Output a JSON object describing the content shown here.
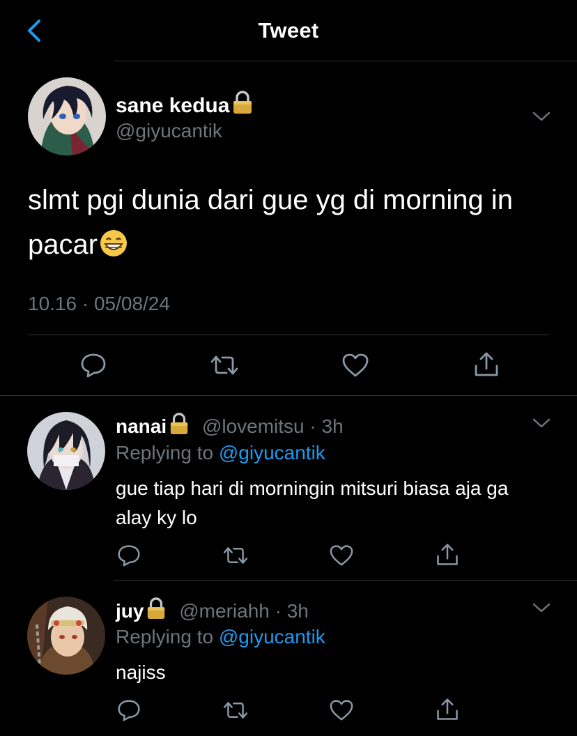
{
  "header": {
    "title": "Tweet"
  },
  "tweet": {
    "display_name": "sane kedua",
    "handle": "@giyucantik",
    "text": "slmt pgi dunia dari gue yg di morning in pacar",
    "timestamp": "10.16 · 05/08/24"
  },
  "replies": [
    {
      "display_name": "nanai",
      "handle": "@lovemitsu",
      "time": "· 3h",
      "replying_label": "Replying to",
      "replying_to": "@giyucantik",
      "text": "gue tiap hari di morningin mitsuri biasa aja ga alay ky lo"
    },
    {
      "display_name": "juy",
      "handle": "@meriahh",
      "time": "· 3h",
      "replying_label": "Replying to",
      "replying_to": "@giyucantik",
      "text": "najiss"
    }
  ],
  "icons": {
    "back": "chevron-left-icon",
    "lock": "lock-icon",
    "menu": "chevron-down-icon",
    "reply": "comment-icon",
    "retweet": "retweet-icon",
    "like": "heart-icon",
    "share": "share-icon",
    "emoji": "grinning-face-emoji"
  },
  "colors": {
    "background": "#000000",
    "text": "#ffffff",
    "muted": "#6e767d",
    "accent": "#1d9bf0",
    "divider": "#2f3336"
  }
}
